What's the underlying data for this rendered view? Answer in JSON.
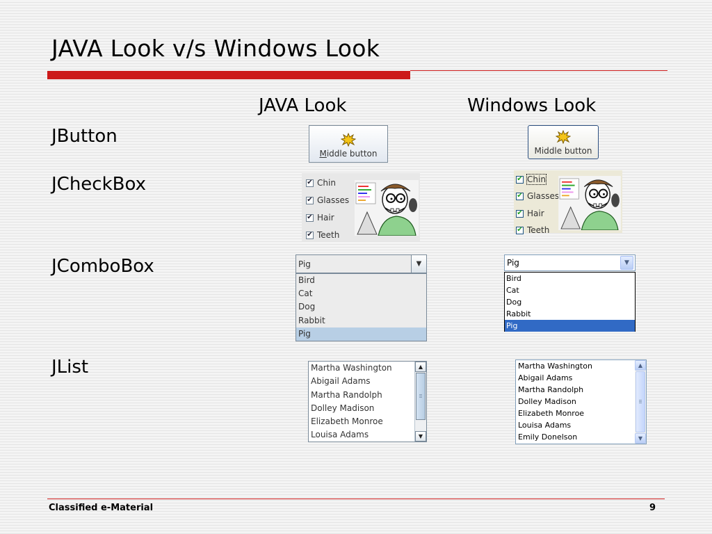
{
  "slide": {
    "title": "JAVA Look v/s Windows Look",
    "columns": {
      "java": "JAVA Look",
      "windows": "Windows Look"
    },
    "rows": {
      "button": "JButton",
      "checkbox": "JCheckBox",
      "combobox": "JComboBox",
      "list": "JList"
    },
    "footer": {
      "left": "Classified e-Material",
      "page": "9"
    }
  },
  "button": {
    "label": "Middle button",
    "mnemonic": "M"
  },
  "checkboxes": {
    "items": [
      {
        "label": "Chin",
        "checked": true
      },
      {
        "label": "Glasses",
        "checked": true
      },
      {
        "label": "Hair",
        "checked": true
      },
      {
        "label": "Teeth",
        "checked": true
      }
    ]
  },
  "combo": {
    "selected": "Pig",
    "options": [
      "Bird",
      "Cat",
      "Dog",
      "Rabbit",
      "Pig"
    ]
  },
  "list": {
    "java_items": [
      "Martha Washington",
      "Abigail Adams",
      "Martha Randolph",
      "Dolley Madison",
      "Elizabeth Monroe",
      "Louisa Adams"
    ],
    "windows_items": [
      "Martha Washington",
      "Abigail Adams",
      "Martha Randolph",
      "Dolley Madison",
      "Elizabeth Monroe",
      "Louisa Adams",
      "Emily Donelson"
    ]
  },
  "icons": {
    "button_icon": "burst-icon",
    "combo_arrow": "chevron-down-icon",
    "scroll_up": "arrow-up-icon",
    "scroll_down": "arrow-down-icon",
    "check": "checkmark-icon"
  },
  "colors": {
    "accent_red": "#cc1a1a",
    "windows_selection": "#316ac5",
    "java_selection": "#b8cfe5"
  }
}
